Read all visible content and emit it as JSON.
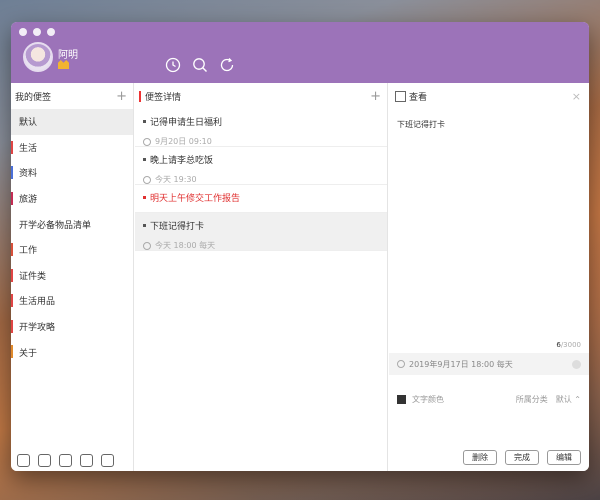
{
  "user": {
    "name": "阿明",
    "badge_icon": "vip-crown-icon"
  },
  "toolbar": {
    "icons": [
      "clock-icon",
      "search-icon",
      "sync-icon"
    ]
  },
  "sidebar": {
    "title": "我的便签",
    "add_icon": "+",
    "selected": "默认",
    "items": [
      {
        "label": "默认",
        "color": ""
      },
      {
        "label": "生活",
        "color": "#e04545"
      },
      {
        "label": "资料",
        "color": "#4a6fd8"
      },
      {
        "label": "旅游",
        "color": "#c42c55"
      },
      {
        "label": "开学必备物品清单",
        "color": ""
      },
      {
        "label": "工作",
        "color": "#d8503b"
      },
      {
        "label": "证件类",
        "color": "#e04545"
      },
      {
        "label": "生活用品",
        "color": "#e04545"
      },
      {
        "label": "开学攻略",
        "color": "#e04545"
      },
      {
        "label": "关于",
        "color": "#e08a2c"
      }
    ],
    "footer_icons": [
      "lock-icon",
      "car-icon",
      "skin-icon",
      "cloud-icon",
      "settings-icon"
    ]
  },
  "notes": {
    "title": "便签详情",
    "add_icon": "+",
    "items": [
      {
        "title": "记得申请生日福利",
        "meta": "9月20日 09:10",
        "red": false
      },
      {
        "title": "晚上请李总吃饭",
        "meta": "今天 19:30",
        "red": false
      },
      {
        "title": "明天上午修交工作报告",
        "meta": "",
        "red": true
      },
      {
        "title": "下班记得打卡",
        "meta": "今天 18:00  每天",
        "red": false
      }
    ]
  },
  "detail": {
    "title": "查看",
    "close": "×",
    "content": "下班记得打卡",
    "counter_used": "6",
    "counter_total": "/3000",
    "reminder": "2019年9月17日 18:00 每天",
    "text_color_label": "文字颜色",
    "category_label": "所属分类",
    "category_value": "默认 ⌃",
    "buttons": {
      "delete": "删除",
      "done": "完成",
      "edit": "编辑"
    }
  }
}
